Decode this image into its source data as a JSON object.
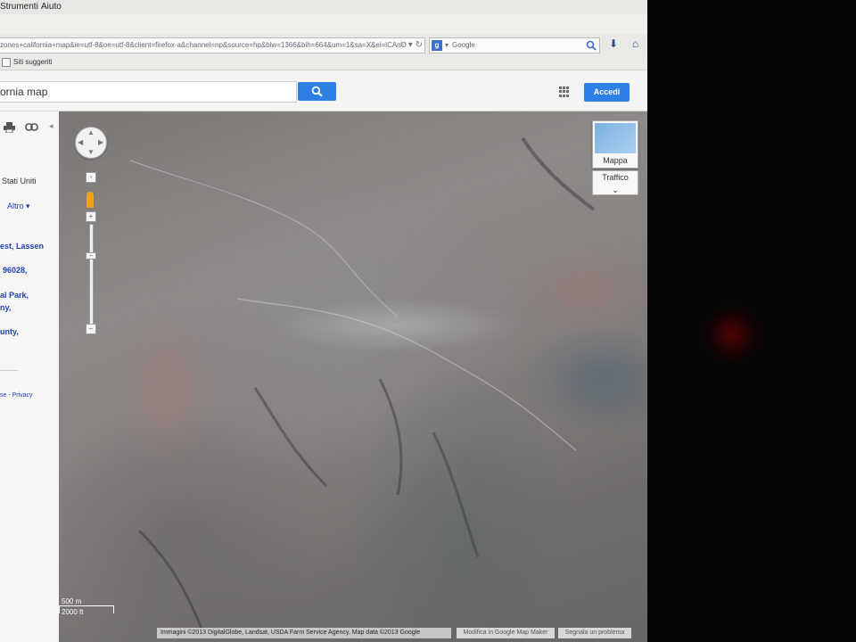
{
  "menubar": {
    "tools": "Strumenti",
    "help": "Aiuto"
  },
  "browser": {
    "url": "zones+california+map&ie=utf-8&oe=utf-8&client=firefox-a&channel=np&source=hp&biw=1366&bih=664&um=1&sa=X&ei=lCAnO",
    "search_engine_placeholder": "Google",
    "bookmark": "Siti suggeriti"
  },
  "gmaps": {
    "query": "ornia map",
    "sign_in": "Accedi"
  },
  "left_panel": {
    "country": "Stati Uniti",
    "more": "Altro",
    "results": [
      "est, Lassen",
      "96028,",
      "al Park,",
      "ny,",
      "unty,"
    ],
    "footer": "se - Privacy"
  },
  "map": {
    "map_type_label": "Mappa",
    "traffic_label": "Traffico",
    "scale_metric": "500 m",
    "scale_imperial": "2000 ft",
    "attribution": "Immagini ©2013 DigitalGlobe, Landsat, USDA Farm Service Agency, Map data ©2013 Google",
    "edit_link": "Modifica in Google Map Maker",
    "report_link": "Segnala un problema"
  },
  "icons": {
    "search": "search-icon",
    "apps": "apps-grid-icon",
    "print": "print-icon",
    "link": "link-icon",
    "pan": "pan-control-icon",
    "pegman": "pegman-icon"
  }
}
